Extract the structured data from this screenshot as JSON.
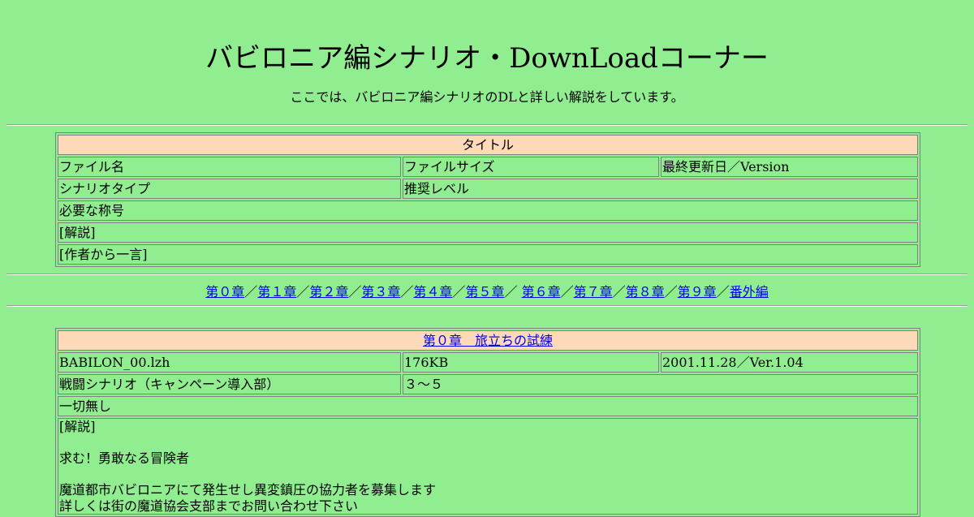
{
  "header": {
    "title": "バビロニア編シナリオ・DownLoadコーナー",
    "subtitle": "ここでは、バビロニア編シナリオのDLと詳しい解説をしています。"
  },
  "legend_table": {
    "title": "タイトル",
    "file_name": "ファイル名",
    "file_size": "ファイルサイズ",
    "updated": "最終更新日／Version",
    "scenario_type": "シナリオタイプ",
    "recommended_level": "推奨レベル",
    "required_title": "必要な称号",
    "commentary": "[解説]",
    "author_note": "[作者から一言]"
  },
  "chapter_nav": {
    "items": [
      "第０章",
      "第１章",
      "第２章",
      "第３章",
      "第４章",
      "第５章",
      "第６章",
      "第７章",
      "第８章",
      "第９章",
      "番外編"
    ],
    "separator": "／"
  },
  "chapter0": {
    "title": "第０章　旅立ちの試練",
    "file_name": "BABILON_00.lzh",
    "file_size": "176KB",
    "updated": "2001.11.28／Ver.1.04",
    "scenario_type": "戦闘シナリオ（キャンペーン導入部）",
    "recommended_level": "３～５",
    "required_title": "一切無し",
    "commentary_lines": [
      "[解説]",
      "",
      "求む！勇敢なる冒険者",
      "",
      "魔道都市バビロニアにて発生せし異変鎮圧の協力者を募集します",
      "詳しくは街の魔道協会支部までお問い合わせ下さい"
    ]
  }
}
